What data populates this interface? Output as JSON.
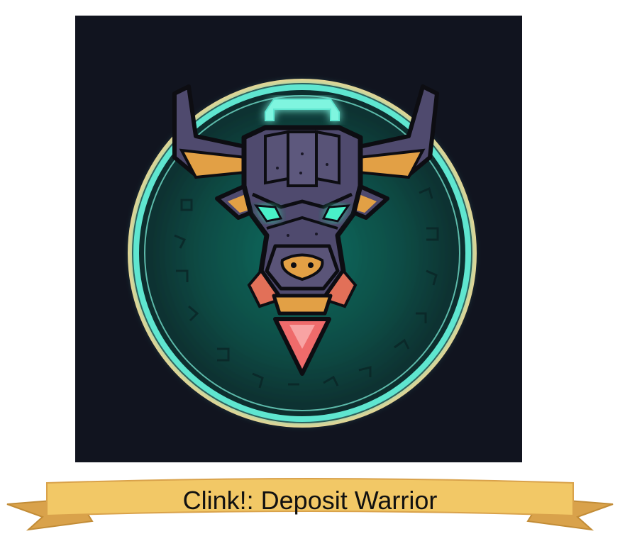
{
  "badge": {
    "title": "Clink!: Deposit Warrior",
    "icon": "bull-head-icon",
    "colors": {
      "background": "#11141f",
      "ring_glow": "#5fe6d0",
      "ring_outer": "#f1d38e",
      "ring_inner_fill": "#0f5a50",
      "bull_body": "#4f4a6e",
      "bull_outline": "#0d0d12",
      "bull_accent": "#e2a045",
      "eyes": "#48f0c8",
      "gem": "#ef6b6b",
      "ribbon_face": "#f2c866",
      "ribbon_tail": "#d9a24b"
    }
  }
}
